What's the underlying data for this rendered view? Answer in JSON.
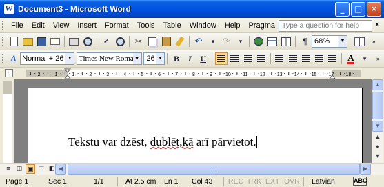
{
  "window": {
    "title": "Document3 - Microsoft Word",
    "app_icon_letter": "W"
  },
  "menu": {
    "items": [
      "File",
      "Edit",
      "View",
      "Insert",
      "Format",
      "Tools",
      "Table",
      "Window",
      "Help",
      "Pragma"
    ],
    "help_placeholder": "Type a question for help",
    "close_glyph": "×"
  },
  "standard_toolbar": {
    "zoom_value": "68%"
  },
  "formatting_toolbar": {
    "style_value": "Normal + 26 pt",
    "font_value": "Times New Roman",
    "size_value": "26",
    "bold_label": "B",
    "italic_label": "I",
    "underline_label": "U",
    "font_color_label": "A"
  },
  "ruler": {
    "labels": [
      "2",
      "1",
      "1",
      "2",
      "3",
      "4",
      "5",
      "6",
      "7",
      "8",
      "9",
      "10",
      "11",
      "12",
      "13",
      "14",
      "15",
      "17",
      "18"
    ]
  },
  "document": {
    "text_before": "Tekstu var dzēst, ",
    "text_misspelled": "dublēt,kā",
    "text_after": " arī pārvietot."
  },
  "status": {
    "page": "Page 1",
    "sec": "Sec 1",
    "pages": "1/1",
    "at": "At 2.5 cm",
    "ln": "Ln 1",
    "col": "Col 43",
    "rec": "REC",
    "trk": "TRK",
    "ext": "EXT",
    "ovr": "OVR",
    "language": "Latvian",
    "spell_icon_label": "ABC"
  },
  "colors": {
    "titlebar": "#0053e1",
    "font_color_accent": "#e02020",
    "active_button": "#ffd98f"
  }
}
